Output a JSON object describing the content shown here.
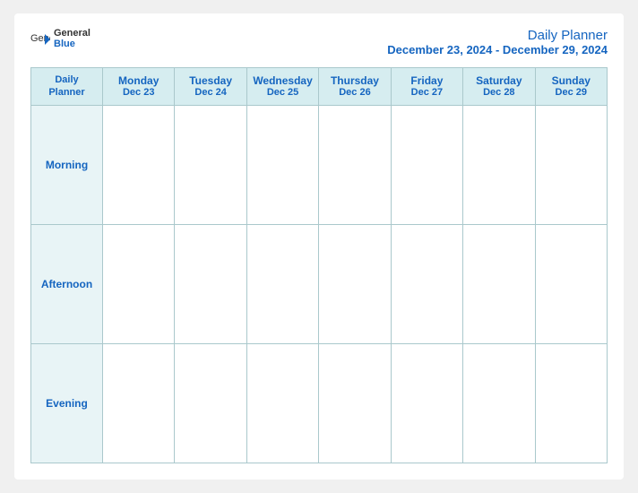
{
  "header": {
    "logo_general": "General",
    "logo_blue": "Blue",
    "title": "Daily Planner",
    "date_range": "December 23, 2024 - December 29, 2024"
  },
  "table": {
    "label_header_line1": "Daily",
    "label_header_line2": "Planner",
    "columns": [
      {
        "day": "Monday",
        "date": "Dec 23"
      },
      {
        "day": "Tuesday",
        "date": "Dec 24"
      },
      {
        "day": "Wednesday",
        "date": "Dec 25"
      },
      {
        "day": "Thursday",
        "date": "Dec 26"
      },
      {
        "day": "Friday",
        "date": "Dec 27"
      },
      {
        "day": "Saturday",
        "date": "Dec 28"
      },
      {
        "day": "Sunday",
        "date": "Dec 29"
      }
    ],
    "rows": [
      {
        "label": "Morning"
      },
      {
        "label": "Afternoon"
      },
      {
        "label": "Evening"
      }
    ]
  }
}
